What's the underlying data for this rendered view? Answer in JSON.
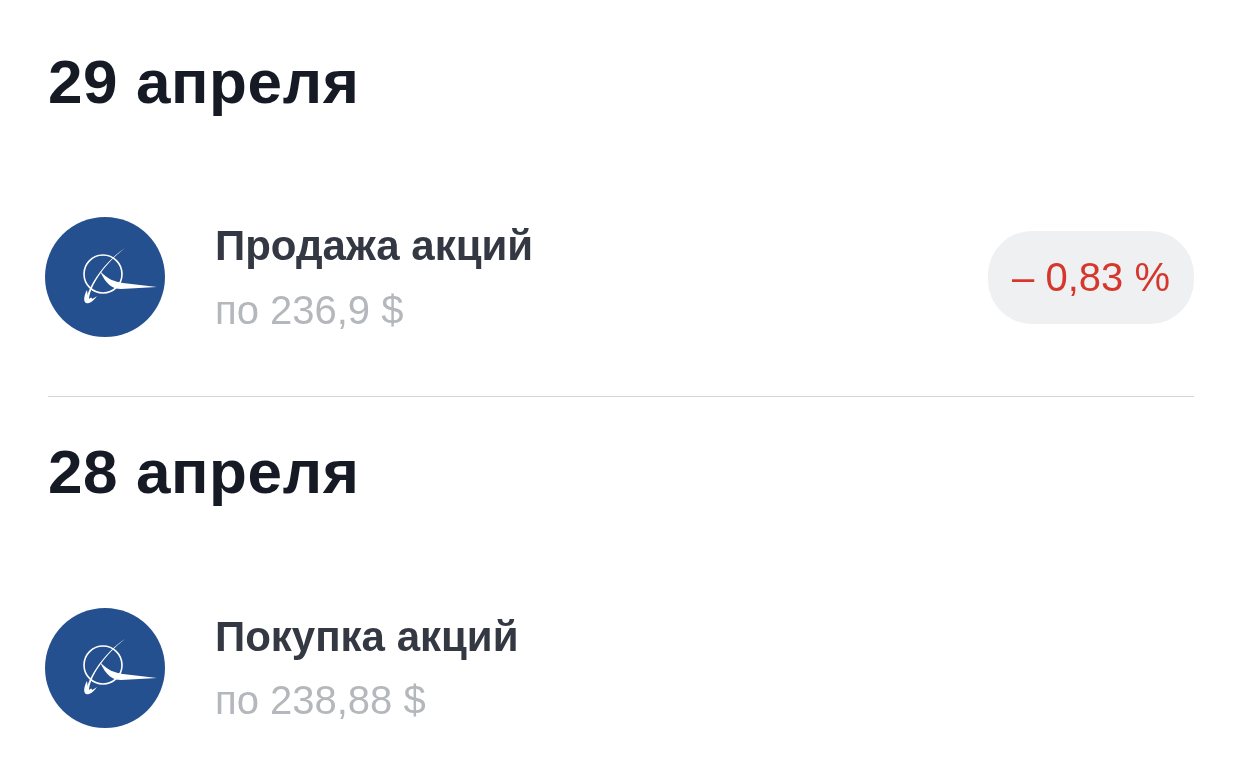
{
  "sections": [
    {
      "date": "29 апреля",
      "operations": [
        {
          "title": "Продажа акций",
          "price": "по 236,9 $",
          "change": {
            "text": "– 0,83 %",
            "negative": true
          }
        }
      ]
    },
    {
      "date": "28 апреля",
      "operations": [
        {
          "title": "Покупка акций",
          "price": "по 238,88 $"
        }
      ]
    }
  ]
}
